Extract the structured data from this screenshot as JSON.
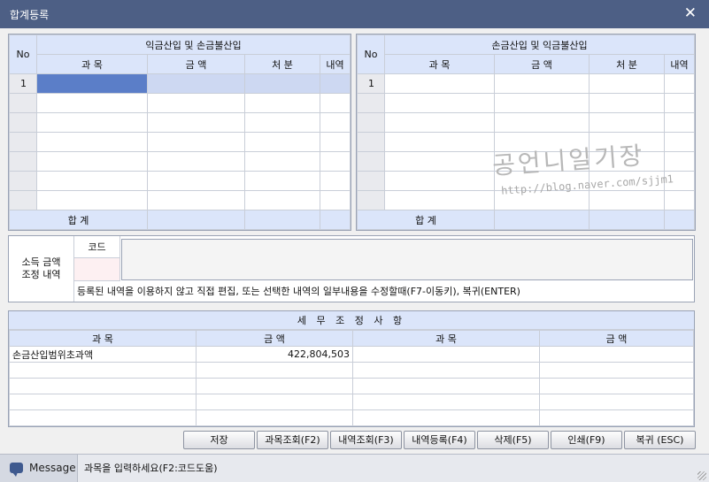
{
  "window": {
    "title": "합계등록",
    "close_glyph": "✕"
  },
  "left_grid": {
    "group_header": "익금산입 및 손금불산입",
    "no_header": "No",
    "columns": [
      "과    목",
      "금    액",
      "처    분",
      "내역"
    ],
    "first_row_no": "1",
    "total_label": "합   계"
  },
  "right_grid": {
    "group_header": "손금산입 및 익금불산입",
    "no_header": "No",
    "columns": [
      "과    목",
      "금    액",
      "처    분",
      "내역"
    ],
    "first_row_no": "1",
    "total_label": "합   계"
  },
  "adjustment": {
    "label_line1": "소득 금액",
    "label_line2": "조정 내역",
    "code_header": "코드",
    "hint": "등록된 내역을 이용하지 않고 직접 편집, 또는 선택한 내역의 일부내용을 수정할때(F7-이동키), 복귀(ENTER)"
  },
  "tax_items": {
    "title": "세 무 조 정 사 항",
    "columns": [
      "과          목",
      "금       액",
      "과          목",
      "금       액"
    ],
    "rows": [
      [
        "손금산입범위초과액",
        "422,804,503",
        "",
        ""
      ]
    ]
  },
  "buttons": {
    "save": "저장",
    "account_lookup": "과목조회(F2)",
    "detail_lookup": "내역조회(F3)",
    "detail_register": "내역등록(F4)",
    "delete": "삭제(F5)",
    "print": "인쇄(F9)",
    "restore": "복귀 (ESC)"
  },
  "message": {
    "tag": "Message",
    "text": "과목을 입력하세요(F2:코드도움)"
  },
  "watermark": {
    "name": "공언니일기장",
    "url": "http://blog.naver.com/sjjm1"
  },
  "colors": {
    "titlebar": "#4d5f85",
    "header": "#dbe5fa",
    "selected_cell": "#5b7ec8"
  }
}
